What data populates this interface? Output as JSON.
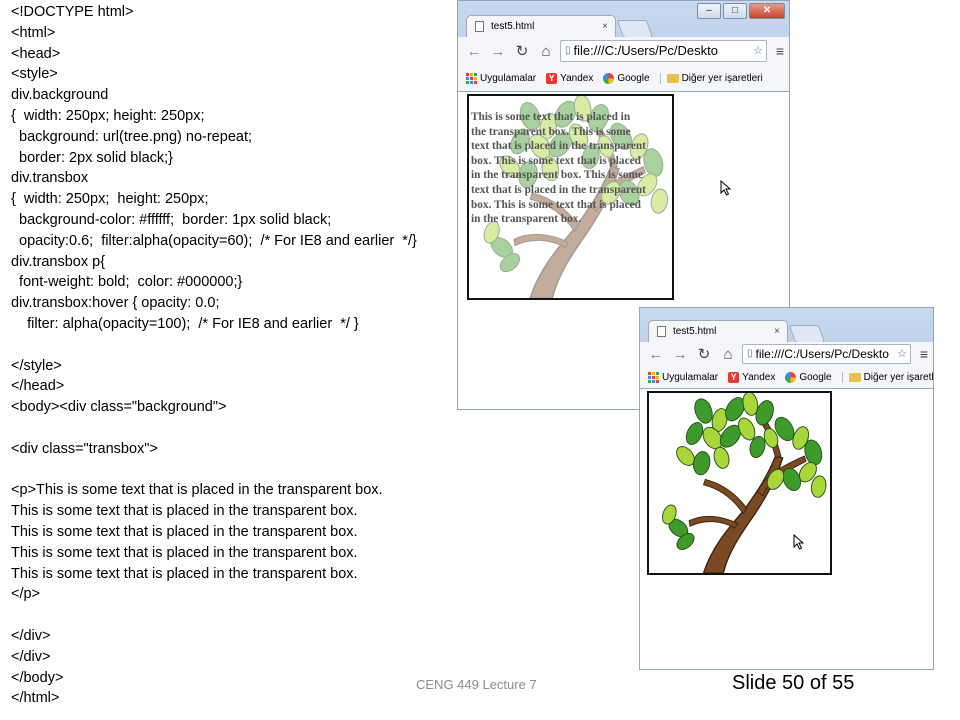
{
  "code_lines": [
    "<!DOCTYPE html>",
    "<html>",
    "<head>",
    "<style>",
    "div.background",
    "{  width: 250px; height: 250px;",
    "  background: url(tree.png) no-repeat;",
    "  border: 2px solid black;}",
    "div.transbox",
    "{  width: 250px;  height: 250px;",
    "  background-color: #ffffff;  border: 1px solid black;",
    "  opacity:0.6;  filter:alpha(opacity=60);  /* For IE8 and earlier  */}",
    "div.transbox p{",
    "  font-weight: bold;  color: #000000;}",
    "div.transbox:hover { opacity: 0.0;",
    "    filter: alpha(opacity=100);  /* For IE8 and earlier  */ }",
    "",
    "</style>",
    "</head>",
    "<body><div class=\"background\">",
    "",
    "<div class=\"transbox\">",
    "",
    "<p>This is some text that is placed in the transparent box.",
    "This is some text that is placed in the transparent box.",
    "This is some text that is placed in the transparent box.",
    "This is some text that is placed in the transparent box.",
    "This is some text that is placed in the transparent box.",
    "</p>",
    "",
    "</div>",
    "</div>",
    "</body>",
    "</html>"
  ],
  "footer": "CENG 449 Lecture 7",
  "slide_number": "Slide 50 of 55",
  "browser": {
    "tab_title": "test5.html",
    "tab_close": "×",
    "url": "file:///C:/Users/Pc/Deskto",
    "bookmarks": [
      "Uygulamalar",
      "Yandex",
      "Google",
      "Diğer yer işaretleri"
    ],
    "window_buttons": [
      "–",
      "□",
      "✕"
    ]
  },
  "browser2": {
    "url": "file:///C:/Users/Pc/Deskto"
  },
  "transbox_text_lines": [
    "This is some text that is placed in",
    "the transparent box. This is some",
    "text that is placed in the transparent",
    "box. This is some text that is placed",
    "in the transparent box. This is some",
    "text that is placed in the transparent",
    "box. This is some text that is placed",
    "in the transparent box."
  ],
  "colors": {
    "leaf_dark": "#3f9a2c",
    "leaf_light": "#a9d63a",
    "trunk": "#7a4a25",
    "text": "#555555"
  }
}
